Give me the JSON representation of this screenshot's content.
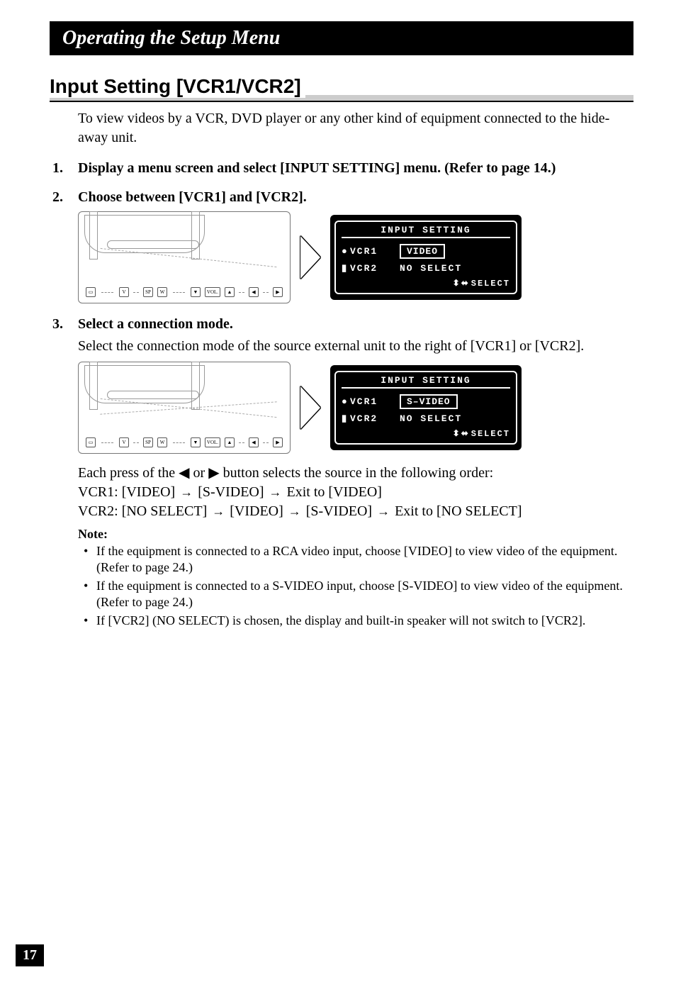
{
  "chapterTitle": "Operating the Setup Menu",
  "sectionHeading": "Input Setting [VCR1/VCR2]",
  "intro": "To view videos by a VCR, DVD player or any other kind of equipment connected to the hide-away unit.",
  "steps": {
    "s1_num": "1.",
    "s1_text": "Display a menu screen and select [INPUT SETTING] menu. (Refer to page 14.)",
    "s2_num": "2.",
    "s2_text": "Choose between [VCR1] and [VCR2].",
    "s3_num": "3.",
    "s3_text": "Select a connection mode.",
    "s3_sub": "Select the connection mode of the source external unit to the right of [VCR1] or [VCR2]."
  },
  "osd": {
    "title": "INPUT SETTING",
    "row1_label": "VCR1",
    "row2_label": "VCR2",
    "panel1_val1": "VIDEO",
    "panel1_val2": "NO  SELECT",
    "panel2_val1": "S–VIDEO",
    "panel2_val2": "NO  SELECT",
    "footer": "SELECT"
  },
  "remoteButtons": {
    "v": "V",
    "sp": "SP",
    "w": "W",
    "down": "▼",
    "vol": "VOL.",
    "up": "▲",
    "left": "◀",
    "right": "▶"
  },
  "order": {
    "intro": "Each press of the ◀ or ▶ button selects the source in the following order:",
    "vcr1_label": "VCR1: ",
    "vcr1_a": "[VIDEO]",
    "vcr1_b": "[S-VIDEO]",
    "vcr1_c": "Exit to [VIDEO]",
    "vcr2_label": "VCR2: ",
    "vcr2_a": "[NO SELECT]",
    "vcr2_b": "[VIDEO]",
    "vcr2_c": "[S-VIDEO]",
    "vcr2_d": "Exit to [NO SELECT]"
  },
  "notes": {
    "head": "Note:",
    "n1": "If the equipment is connected to a RCA video input, choose [VIDEO] to view video of the equipment. (Refer to page 24.)",
    "n2": "If the equipment is connected to a S-VIDEO input, choose [S-VIDEO] to view video of the equipment. (Refer to page 24.)",
    "n3": "If [VCR2] (NO SELECT) is chosen, the display and built-in speaker will not switch to [VCR2]."
  },
  "pageNumber": "17"
}
